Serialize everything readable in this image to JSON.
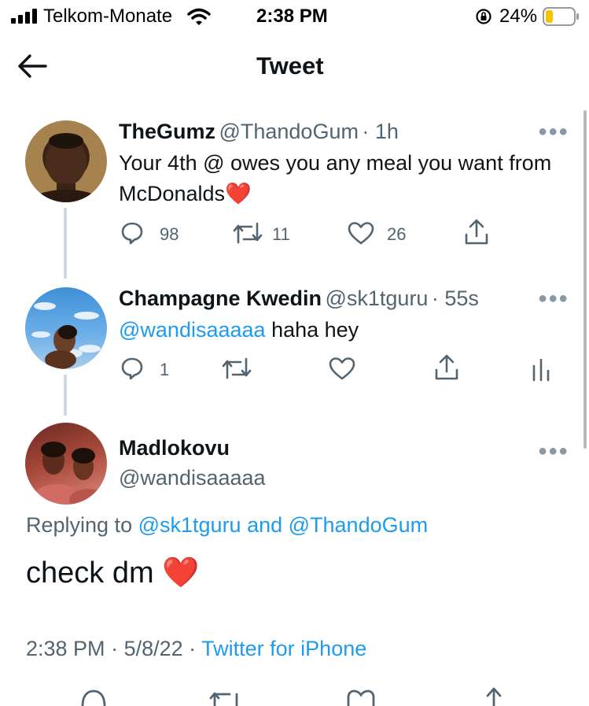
{
  "status_bar": {
    "carrier": "Telkom-Monate",
    "time": "2:38 PM",
    "battery": "24%"
  },
  "header": {
    "title": "Tweet"
  },
  "tweets": [
    {
      "name": "TheGumz",
      "handle": "@ThandoGum",
      "age": "· 1h",
      "text": "Your 4th @ owes you any meal you want from McDonalds",
      "emoji": "❤️",
      "replies": "98",
      "retweets": "11",
      "likes": "26"
    },
    {
      "name": "Champagne Kwedin",
      "handle": "@sk1tguru",
      "age": "· 55s",
      "mention": "@wandisaaaaa",
      "text": "haha hey",
      "replies": "1"
    }
  ],
  "main_tweet": {
    "name": "Madlokovu",
    "handle": "@wandisaaaaa",
    "replying_label": "Replying to",
    "replying_users": "@sk1tguru and @ThandoGum",
    "text": "check dm",
    "emoji": "❤️",
    "time": "2:38 PM",
    "date": "· 5/8/22 ·",
    "source": "Twitter for iPhone"
  },
  "colors": {
    "accent": "#1d9bf0",
    "heart": "#e0245e",
    "muted": "#536471"
  }
}
